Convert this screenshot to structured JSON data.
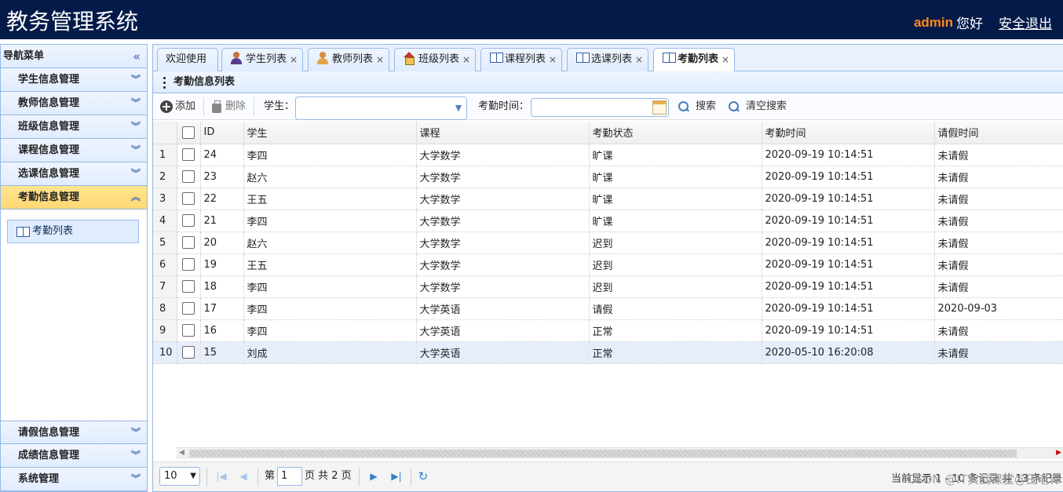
{
  "header": {
    "title": "教务管理系统",
    "user": "admin",
    "greeting": "您好",
    "logout": "安全退出"
  },
  "sidebar": {
    "title": "导航菜单",
    "items": [
      {
        "label": "学生信息管理"
      },
      {
        "label": "教师信息管理"
      },
      {
        "label": "班级信息管理"
      },
      {
        "label": "课程信息管理"
      },
      {
        "label": "选课信息管理"
      },
      {
        "label": "考勤信息管理"
      }
    ],
    "submenu": {
      "label": "考勤列表"
    },
    "bottom_items": [
      {
        "label": "请假信息管理"
      },
      {
        "label": "成绩信息管理"
      },
      {
        "label": "系统管理"
      }
    ]
  },
  "tabs": [
    {
      "label": "欢迎使用"
    },
    {
      "label": "学生列表"
    },
    {
      "label": "教师列表"
    },
    {
      "label": "班级列表"
    },
    {
      "label": "课程列表"
    },
    {
      "label": "选课列表"
    },
    {
      "label": "考勤列表"
    }
  ],
  "panel": {
    "title": "考勤信息列表"
  },
  "toolbar": {
    "add": "添加",
    "delete": "删除",
    "student_label": "学生：",
    "student_value": "",
    "time_label": "考勤时间：",
    "time_value": "",
    "search": "搜索",
    "clear": "清空搜索"
  },
  "grid": {
    "columns": [
      "ID",
      "学生",
      "课程",
      "考勤状态",
      "考勤时间",
      "请假时间"
    ],
    "rows": [
      {
        "n": "1",
        "id": "24",
        "student": "李四",
        "course": "大学数学",
        "status": "旷课",
        "time": "2020-09-19 10:14:51",
        "leave": "未请假"
      },
      {
        "n": "2",
        "id": "23",
        "student": "赵六",
        "course": "大学数学",
        "status": "旷课",
        "time": "2020-09-19 10:14:51",
        "leave": "未请假"
      },
      {
        "n": "3",
        "id": "22",
        "student": "王五",
        "course": "大学数学",
        "status": "旷课",
        "time": "2020-09-19 10:14:51",
        "leave": "未请假"
      },
      {
        "n": "4",
        "id": "21",
        "student": "李四",
        "course": "大学数学",
        "status": "旷课",
        "time": "2020-09-19 10:14:51",
        "leave": "未请假"
      },
      {
        "n": "5",
        "id": "20",
        "student": "赵六",
        "course": "大学数学",
        "status": "迟到",
        "time": "2020-09-19 10:14:51",
        "leave": "未请假"
      },
      {
        "n": "6",
        "id": "19",
        "student": "王五",
        "course": "大学数学",
        "status": "迟到",
        "time": "2020-09-19 10:14:51",
        "leave": "未请假"
      },
      {
        "n": "7",
        "id": "18",
        "student": "李四",
        "course": "大学数学",
        "status": "迟到",
        "time": "2020-09-19 10:14:51",
        "leave": "未请假"
      },
      {
        "n": "8",
        "id": "17",
        "student": "李四",
        "course": "大学英语",
        "status": "请假",
        "time": "2020-09-19 10:14:51",
        "leave": "2020-09-03"
      },
      {
        "n": "9",
        "id": "16",
        "student": "李四",
        "course": "大学英语",
        "status": "正常",
        "time": "2020-09-19 10:14:51",
        "leave": "未请假"
      },
      {
        "n": "10",
        "id": "15",
        "student": "刘成",
        "course": "大学英语",
        "status": "正常",
        "time": "2020-05-10 16:20:08",
        "leave": "未请假"
      }
    ]
  },
  "pager": {
    "page_size": "10",
    "page_label_pre": "第",
    "page": "1",
    "page_label_post": "页 共 2 页",
    "info": "当前显示 1 - 10 条记录 共 13 条记录"
  },
  "watermark": "CSDN @IT实战课堂@田老师",
  "colors": {
    "header_bg": "#041b4a",
    "user_name": "#ff8a1a",
    "active_menu": "#ffd874",
    "border": "#95b8e7"
  }
}
